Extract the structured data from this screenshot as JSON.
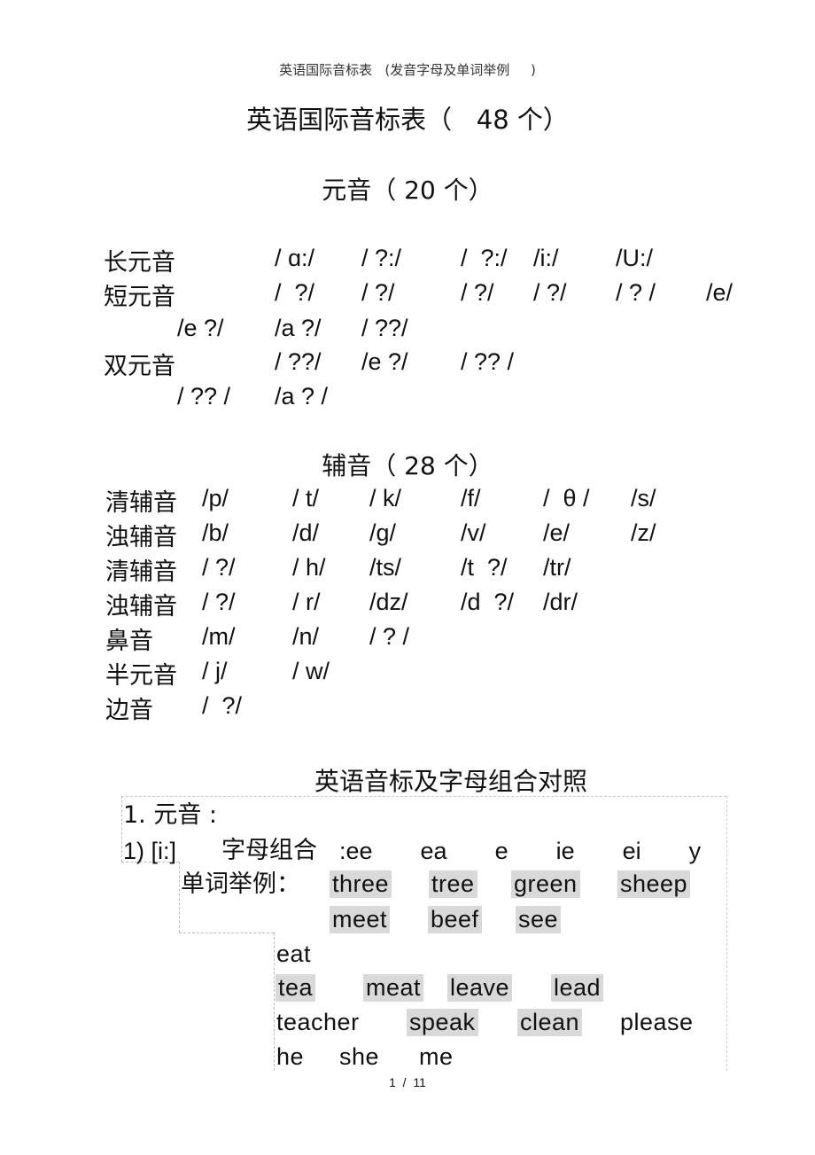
{
  "header": {
    "running_title": "英语国际音标表   (发音字母及单词举例     )"
  },
  "title": "英语国际音标表（   48 个）",
  "vowels": {
    "heading": "元音（ 20 个）",
    "long": {
      "label": "长元音",
      "symbols": [
        "/ ɑ:/",
        "/ ?:/",
        "/  ?:/",
        "/i:/",
        "/U:/"
      ]
    },
    "short": {
      "label": "短元音",
      "symbols": [
        "/  ?/",
        "/ ?/",
        "/ ?/",
        "/ ?/",
        "/ ? /",
        "/e/",
        "/e ?/",
        "/a ?/",
        "/ ??/"
      ]
    },
    "diphthong": {
      "label": "双元音",
      "symbols": [
        "/ ??/",
        "/e ?/",
        "/ ?? /",
        "/ ?? /",
        "/a ? /"
      ]
    }
  },
  "consonants": {
    "heading": "辅音（ 28 个）",
    "rows": [
      {
        "label": "清辅音",
        "symbols": [
          "/p/",
          "/ t/",
          "/ k/",
          "/f/",
          "/  θ /",
          "/s/"
        ]
      },
      {
        "label": "浊辅音",
        "symbols": [
          "/b/",
          "/d/",
          "/g/",
          "/v/",
          "/e/",
          "/z/"
        ]
      },
      {
        "label": "清辅音",
        "symbols": [
          "/ ?/",
          "/ h/",
          "/ts/",
          "/t  ?/",
          "/tr/"
        ]
      },
      {
        "label": "浊辅音",
        "symbols": [
          "/ ?/",
          "/ r/",
          "/dz/",
          "/d  ?/",
          "/dr/"
        ]
      },
      {
        "label": "鼻音",
        "symbols": [
          "/m/",
          "/n/",
          "/ ? /"
        ]
      },
      {
        "label": "半元音",
        "symbols": [
          "/ j/",
          "/ w/"
        ]
      },
      {
        "label": "边音",
        "symbols": [
          "/  ?/"
        ]
      }
    ]
  },
  "comparison": {
    "heading": "英语音标及字母组合对照",
    "section": "1. 元音 :",
    "item": {
      "number_phoneme": "1) [i:]",
      "combo_label": "字母组合",
      "combos": ":ee    ea    e    ie    ei    y",
      "examples_label": "单词举例：",
      "words_line1": [
        "three",
        "tree",
        "green",
        "sheep"
      ],
      "words_line2": [
        "meet",
        "beef",
        "see"
      ],
      "words_line3": [
        "eat"
      ],
      "words_line4": [
        "tea",
        "meat",
        "leave",
        "lead"
      ],
      "words_line5": [
        "teacher",
        "speak",
        "clean",
        "please"
      ],
      "words_line6": [
        "he",
        "she",
        "me"
      ]
    }
  },
  "footer": {
    "page": "1  /  11"
  }
}
